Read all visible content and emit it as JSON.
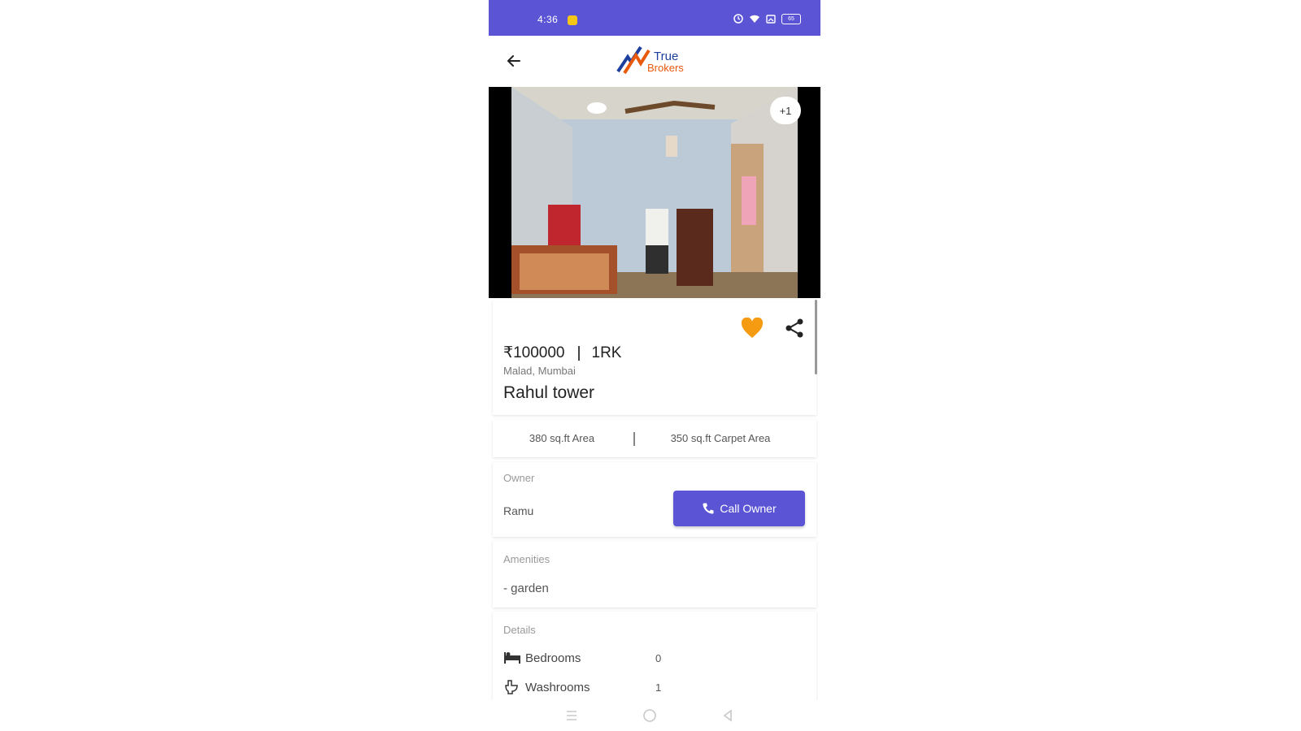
{
  "status_bar": {
    "time": "4:36",
    "battery": "65",
    "bg_color": "#5b55d6"
  },
  "app_bar": {
    "logo_text_top": "True",
    "logo_text_bottom": "Brokers"
  },
  "gallery": {
    "photo_count": "+1"
  },
  "summary": {
    "price": "₹100000",
    "type": "1RK",
    "location": "Malad, Mumbai",
    "name": "Rahul tower",
    "favorite_color": "#f59b12"
  },
  "area": {
    "area": "380 sq.ft Area",
    "carpet_area": "350 sq.ft Carpet Area"
  },
  "owner": {
    "label": "Owner",
    "name": "Ramu",
    "call_button": "Call Owner"
  },
  "amenities": {
    "label": "Amenities",
    "items": [
      "- garden"
    ]
  },
  "details": {
    "label": "Details",
    "rows": [
      {
        "name": "Bedrooms",
        "value": "0",
        "icon": "bed-icon"
      },
      {
        "name": "Washrooms",
        "value": "1",
        "icon": "toilet-icon"
      }
    ]
  },
  "accent_color": "#5b55d6"
}
